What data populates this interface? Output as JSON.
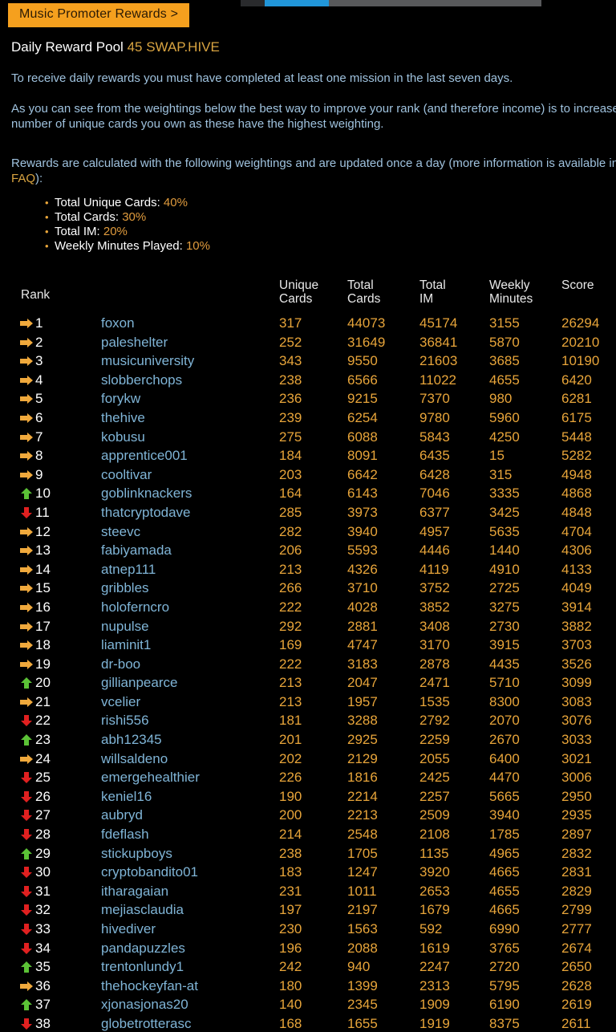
{
  "topbar": {
    "scrollbar_name": "horizontal-scrollbar"
  },
  "header": {
    "promo_button": "Music Promoter Rewards >",
    "pool_label": "Daily Reward Pool",
    "pool_amount": "45 SWAP.HIVE"
  },
  "paragraphs": {
    "p1": "To receive daily rewards you must have completed at least one mission in the last seven days.",
    "p2": "As you can see from the weightings below the best way to improve your rank (and therefore income) is to increase the number of unique cards you own as these have the highest weighting.",
    "p3_before": "Rewards are calculated with the following weightings and are updated once a day (more information is available in the ",
    "p3_link": "FAQ",
    "p3_after": "):"
  },
  "weights": [
    {
      "label": "Total Unique Cards:",
      "pct": "40%"
    },
    {
      "label": "Total Cards:",
      "pct": "30%"
    },
    {
      "label": "Total IM:",
      "pct": "20%"
    },
    {
      "label": "Weekly Minutes Played:",
      "pct": "10%"
    }
  ],
  "table": {
    "headers": {
      "rank": "Rank",
      "unique_cards": "Unique\nCards",
      "total_cards": "Total\nCards",
      "total_im": "Total\nIM",
      "weekly_minutes": "Weekly\nMinutes",
      "score": "Score"
    },
    "colors": {
      "up": "#5bc236",
      "down": "#e02020",
      "same": "#f0a93c",
      "value": "#e8a53a",
      "user": "#7fb4d6"
    },
    "rows": [
      {
        "trend": "same",
        "rank": "1",
        "user": "foxon",
        "unique_cards": "317",
        "total_cards": "44073",
        "total_im": "45174",
        "weekly_minutes": "3155",
        "score": "26294"
      },
      {
        "trend": "same",
        "rank": "2",
        "user": "paleshelter",
        "unique_cards": "252",
        "total_cards": "31649",
        "total_im": "36841",
        "weekly_minutes": "5870",
        "score": "20210"
      },
      {
        "trend": "same",
        "rank": "3",
        "user": "musicuniversity",
        "unique_cards": "343",
        "total_cards": "9550",
        "total_im": "21603",
        "weekly_minutes": "3685",
        "score": "10190"
      },
      {
        "trend": "same",
        "rank": "4",
        "user": "slobberchops",
        "unique_cards": "238",
        "total_cards": "6566",
        "total_im": "11022",
        "weekly_minutes": "4655",
        "score": "6420"
      },
      {
        "trend": "same",
        "rank": "5",
        "user": "forykw",
        "unique_cards": "236",
        "total_cards": "9215",
        "total_im": "7370",
        "weekly_minutes": "980",
        "score": "6281"
      },
      {
        "trend": "same",
        "rank": "6",
        "user": "thehive",
        "unique_cards": "239",
        "total_cards": "6254",
        "total_im": "9780",
        "weekly_minutes": "5960",
        "score": "6175"
      },
      {
        "trend": "same",
        "rank": "7",
        "user": "kobusu",
        "unique_cards": "275",
        "total_cards": "6088",
        "total_im": "5843",
        "weekly_minutes": "4250",
        "score": "5448"
      },
      {
        "trend": "same",
        "rank": "8",
        "user": "apprentice001",
        "unique_cards": "184",
        "total_cards": "8091",
        "total_im": "6435",
        "weekly_minutes": "15",
        "score": "5282"
      },
      {
        "trend": "same",
        "rank": "9",
        "user": "cooltivar",
        "unique_cards": "203",
        "total_cards": "6642",
        "total_im": "6428",
        "weekly_minutes": "315",
        "score": "4948"
      },
      {
        "trend": "up",
        "rank": "10",
        "user": "goblinknackers",
        "unique_cards": "164",
        "total_cards": "6143",
        "total_im": "7046",
        "weekly_minutes": "3335",
        "score": "4868"
      },
      {
        "trend": "down",
        "rank": "11",
        "user": "thatcryptodave",
        "unique_cards": "285",
        "total_cards": "3973",
        "total_im": "6377",
        "weekly_minutes": "3425",
        "score": "4848"
      },
      {
        "trend": "same",
        "rank": "12",
        "user": "steevc",
        "unique_cards": "282",
        "total_cards": "3940",
        "total_im": "4957",
        "weekly_minutes": "5635",
        "score": "4704"
      },
      {
        "trend": "same",
        "rank": "13",
        "user": "fabiyamada",
        "unique_cards": "206",
        "total_cards": "5593",
        "total_im": "4446",
        "weekly_minutes": "1440",
        "score": "4306"
      },
      {
        "trend": "same",
        "rank": "14",
        "user": "atnep111",
        "unique_cards": "213",
        "total_cards": "4326",
        "total_im": "4119",
        "weekly_minutes": "4910",
        "score": "4133"
      },
      {
        "trend": "same",
        "rank": "15",
        "user": "gribbles",
        "unique_cards": "266",
        "total_cards": "3710",
        "total_im": "3752",
        "weekly_minutes": "2725",
        "score": "4049"
      },
      {
        "trend": "same",
        "rank": "16",
        "user": "holoferncro",
        "unique_cards": "222",
        "total_cards": "4028",
        "total_im": "3852",
        "weekly_minutes": "3275",
        "score": "3914"
      },
      {
        "trend": "same",
        "rank": "17",
        "user": "nupulse",
        "unique_cards": "292",
        "total_cards": "2881",
        "total_im": "3408",
        "weekly_minutes": "2730",
        "score": "3882"
      },
      {
        "trend": "same",
        "rank": "18",
        "user": "liaminit1",
        "unique_cards": "169",
        "total_cards": "4747",
        "total_im": "3170",
        "weekly_minutes": "3915",
        "score": "3703"
      },
      {
        "trend": "same",
        "rank": "19",
        "user": "dr-boo",
        "unique_cards": "222",
        "total_cards": "3183",
        "total_im": "2878",
        "weekly_minutes": "4435",
        "score": "3526"
      },
      {
        "trend": "up",
        "rank": "20",
        "user": "gillianpearce",
        "unique_cards": "213",
        "total_cards": "2047",
        "total_im": "2471",
        "weekly_minutes": "5710",
        "score": "3099"
      },
      {
        "trend": "same",
        "rank": "21",
        "user": "vcelier",
        "unique_cards": "213",
        "total_cards": "1957",
        "total_im": "1535",
        "weekly_minutes": "8300",
        "score": "3083"
      },
      {
        "trend": "down",
        "rank": "22",
        "user": "rishi556",
        "unique_cards": "181",
        "total_cards": "3288",
        "total_im": "2792",
        "weekly_minutes": "2070",
        "score": "3076"
      },
      {
        "trend": "up",
        "rank": "23",
        "user": "abh12345",
        "unique_cards": "201",
        "total_cards": "2925",
        "total_im": "2259",
        "weekly_minutes": "2670",
        "score": "3033"
      },
      {
        "trend": "same",
        "rank": "24",
        "user": "willsaldeno",
        "unique_cards": "202",
        "total_cards": "2129",
        "total_im": "2055",
        "weekly_minutes": "6400",
        "score": "3021"
      },
      {
        "trend": "down",
        "rank": "25",
        "user": "emergehealthier",
        "unique_cards": "226",
        "total_cards": "1816",
        "total_im": "2425",
        "weekly_minutes": "4470",
        "score": "3006"
      },
      {
        "trend": "down",
        "rank": "26",
        "user": "keniel16",
        "unique_cards": "190",
        "total_cards": "2214",
        "total_im": "2257",
        "weekly_minutes": "5665",
        "score": "2950"
      },
      {
        "trend": "down",
        "rank": "27",
        "user": "aubryd",
        "unique_cards": "200",
        "total_cards": "2213",
        "total_im": "2509",
        "weekly_minutes": "3940",
        "score": "2935"
      },
      {
        "trend": "down",
        "rank": "28",
        "user": "fdeflash",
        "unique_cards": "214",
        "total_cards": "2548",
        "total_im": "2108",
        "weekly_minutes": "1785",
        "score": "2897"
      },
      {
        "trend": "up",
        "rank": "29",
        "user": "stickupboys",
        "unique_cards": "238",
        "total_cards": "1705",
        "total_im": "1135",
        "weekly_minutes": "4965",
        "score": "2832"
      },
      {
        "trend": "down",
        "rank": "30",
        "user": "cryptobandito01",
        "unique_cards": "183",
        "total_cards": "1247",
        "total_im": "3920",
        "weekly_minutes": "4665",
        "score": "2831"
      },
      {
        "trend": "down",
        "rank": "31",
        "user": "itharagaian",
        "unique_cards": "231",
        "total_cards": "1011",
        "total_im": "2653",
        "weekly_minutes": "4655",
        "score": "2829"
      },
      {
        "trend": "down",
        "rank": "32",
        "user": "mejiasclaudia",
        "unique_cards": "197",
        "total_cards": "2197",
        "total_im": "1679",
        "weekly_minutes": "4665",
        "score": "2799"
      },
      {
        "trend": "down",
        "rank": "33",
        "user": "hivediver",
        "unique_cards": "230",
        "total_cards": "1563",
        "total_im": "592",
        "weekly_minutes": "6990",
        "score": "2777"
      },
      {
        "trend": "down",
        "rank": "34",
        "user": "pandapuzzles",
        "unique_cards": "196",
        "total_cards": "2088",
        "total_im": "1619",
        "weekly_minutes": "3765",
        "score": "2674"
      },
      {
        "trend": "up",
        "rank": "35",
        "user": "trentonlundy1",
        "unique_cards": "242",
        "total_cards": "940",
        "total_im": "2247",
        "weekly_minutes": "2720",
        "score": "2650"
      },
      {
        "trend": "same",
        "rank": "36",
        "user": "thehockeyfan-at",
        "unique_cards": "180",
        "total_cards": "1399",
        "total_im": "2313",
        "weekly_minutes": "5795",
        "score": "2628"
      },
      {
        "trend": "up",
        "rank": "37",
        "user": "xjonasjonas20",
        "unique_cards": "140",
        "total_cards": "2345",
        "total_im": "1909",
        "weekly_minutes": "6190",
        "score": "2619"
      },
      {
        "trend": "down",
        "rank": "38",
        "user": "globetrotterasc",
        "unique_cards": "168",
        "total_cards": "1655",
        "total_im": "1919",
        "weekly_minutes": "8375",
        "score": "2611"
      }
    ]
  }
}
